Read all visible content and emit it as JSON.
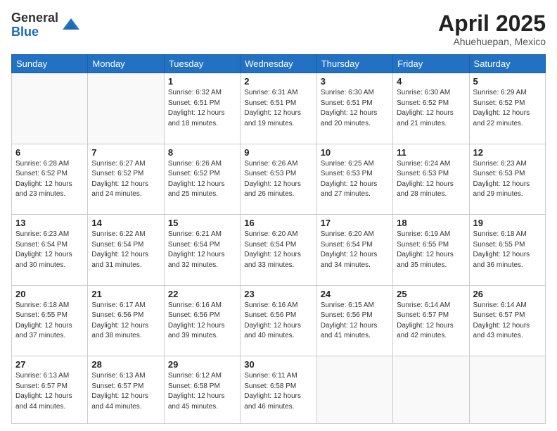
{
  "logo": {
    "general": "General",
    "blue": "Blue"
  },
  "header": {
    "title": "April 2025",
    "location": "Ahuehuepan, Mexico"
  },
  "days_of_week": [
    "Sunday",
    "Monday",
    "Tuesday",
    "Wednesday",
    "Thursday",
    "Friday",
    "Saturday"
  ],
  "weeks": [
    [
      {
        "day": "",
        "sunrise": "",
        "sunset": "",
        "daylight": ""
      },
      {
        "day": "",
        "sunrise": "",
        "sunset": "",
        "daylight": ""
      },
      {
        "day": "1",
        "sunrise": "Sunrise: 6:32 AM",
        "sunset": "Sunset: 6:51 PM",
        "daylight": "Daylight: 12 hours and 18 minutes."
      },
      {
        "day": "2",
        "sunrise": "Sunrise: 6:31 AM",
        "sunset": "Sunset: 6:51 PM",
        "daylight": "Daylight: 12 hours and 19 minutes."
      },
      {
        "day": "3",
        "sunrise": "Sunrise: 6:30 AM",
        "sunset": "Sunset: 6:51 PM",
        "daylight": "Daylight: 12 hours and 20 minutes."
      },
      {
        "day": "4",
        "sunrise": "Sunrise: 6:30 AM",
        "sunset": "Sunset: 6:52 PM",
        "daylight": "Daylight: 12 hours and 21 minutes."
      },
      {
        "day": "5",
        "sunrise": "Sunrise: 6:29 AM",
        "sunset": "Sunset: 6:52 PM",
        "daylight": "Daylight: 12 hours and 22 minutes."
      }
    ],
    [
      {
        "day": "6",
        "sunrise": "Sunrise: 6:28 AM",
        "sunset": "Sunset: 6:52 PM",
        "daylight": "Daylight: 12 hours and 23 minutes."
      },
      {
        "day": "7",
        "sunrise": "Sunrise: 6:27 AM",
        "sunset": "Sunset: 6:52 PM",
        "daylight": "Daylight: 12 hours and 24 minutes."
      },
      {
        "day": "8",
        "sunrise": "Sunrise: 6:26 AM",
        "sunset": "Sunset: 6:52 PM",
        "daylight": "Daylight: 12 hours and 25 minutes."
      },
      {
        "day": "9",
        "sunrise": "Sunrise: 6:26 AM",
        "sunset": "Sunset: 6:53 PM",
        "daylight": "Daylight: 12 hours and 26 minutes."
      },
      {
        "day": "10",
        "sunrise": "Sunrise: 6:25 AM",
        "sunset": "Sunset: 6:53 PM",
        "daylight": "Daylight: 12 hours and 27 minutes."
      },
      {
        "day": "11",
        "sunrise": "Sunrise: 6:24 AM",
        "sunset": "Sunset: 6:53 PM",
        "daylight": "Daylight: 12 hours and 28 minutes."
      },
      {
        "day": "12",
        "sunrise": "Sunrise: 6:23 AM",
        "sunset": "Sunset: 6:53 PM",
        "daylight": "Daylight: 12 hours and 29 minutes."
      }
    ],
    [
      {
        "day": "13",
        "sunrise": "Sunrise: 6:23 AM",
        "sunset": "Sunset: 6:54 PM",
        "daylight": "Daylight: 12 hours and 30 minutes."
      },
      {
        "day": "14",
        "sunrise": "Sunrise: 6:22 AM",
        "sunset": "Sunset: 6:54 PM",
        "daylight": "Daylight: 12 hours and 31 minutes."
      },
      {
        "day": "15",
        "sunrise": "Sunrise: 6:21 AM",
        "sunset": "Sunset: 6:54 PM",
        "daylight": "Daylight: 12 hours and 32 minutes."
      },
      {
        "day": "16",
        "sunrise": "Sunrise: 6:20 AM",
        "sunset": "Sunset: 6:54 PM",
        "daylight": "Daylight: 12 hours and 33 minutes."
      },
      {
        "day": "17",
        "sunrise": "Sunrise: 6:20 AM",
        "sunset": "Sunset: 6:54 PM",
        "daylight": "Daylight: 12 hours and 34 minutes."
      },
      {
        "day": "18",
        "sunrise": "Sunrise: 6:19 AM",
        "sunset": "Sunset: 6:55 PM",
        "daylight": "Daylight: 12 hours and 35 minutes."
      },
      {
        "day": "19",
        "sunrise": "Sunrise: 6:18 AM",
        "sunset": "Sunset: 6:55 PM",
        "daylight": "Daylight: 12 hours and 36 minutes."
      }
    ],
    [
      {
        "day": "20",
        "sunrise": "Sunrise: 6:18 AM",
        "sunset": "Sunset: 6:55 PM",
        "daylight": "Daylight: 12 hours and 37 minutes."
      },
      {
        "day": "21",
        "sunrise": "Sunrise: 6:17 AM",
        "sunset": "Sunset: 6:56 PM",
        "daylight": "Daylight: 12 hours and 38 minutes."
      },
      {
        "day": "22",
        "sunrise": "Sunrise: 6:16 AM",
        "sunset": "Sunset: 6:56 PM",
        "daylight": "Daylight: 12 hours and 39 minutes."
      },
      {
        "day": "23",
        "sunrise": "Sunrise: 6:16 AM",
        "sunset": "Sunset: 6:56 PM",
        "daylight": "Daylight: 12 hours and 40 minutes."
      },
      {
        "day": "24",
        "sunrise": "Sunrise: 6:15 AM",
        "sunset": "Sunset: 6:56 PM",
        "daylight": "Daylight: 12 hours and 41 minutes."
      },
      {
        "day": "25",
        "sunrise": "Sunrise: 6:14 AM",
        "sunset": "Sunset: 6:57 PM",
        "daylight": "Daylight: 12 hours and 42 minutes."
      },
      {
        "day": "26",
        "sunrise": "Sunrise: 6:14 AM",
        "sunset": "Sunset: 6:57 PM",
        "daylight": "Daylight: 12 hours and 43 minutes."
      }
    ],
    [
      {
        "day": "27",
        "sunrise": "Sunrise: 6:13 AM",
        "sunset": "Sunset: 6:57 PM",
        "daylight": "Daylight: 12 hours and 44 minutes."
      },
      {
        "day": "28",
        "sunrise": "Sunrise: 6:13 AM",
        "sunset": "Sunset: 6:57 PM",
        "daylight": "Daylight: 12 hours and 44 minutes."
      },
      {
        "day": "29",
        "sunrise": "Sunrise: 6:12 AM",
        "sunset": "Sunset: 6:58 PM",
        "daylight": "Daylight: 12 hours and 45 minutes."
      },
      {
        "day": "30",
        "sunrise": "Sunrise: 6:11 AM",
        "sunset": "Sunset: 6:58 PM",
        "daylight": "Daylight: 12 hours and 46 minutes."
      },
      {
        "day": "",
        "sunrise": "",
        "sunset": "",
        "daylight": ""
      },
      {
        "day": "",
        "sunrise": "",
        "sunset": "",
        "daylight": ""
      },
      {
        "day": "",
        "sunrise": "",
        "sunset": "",
        "daylight": ""
      }
    ]
  ]
}
